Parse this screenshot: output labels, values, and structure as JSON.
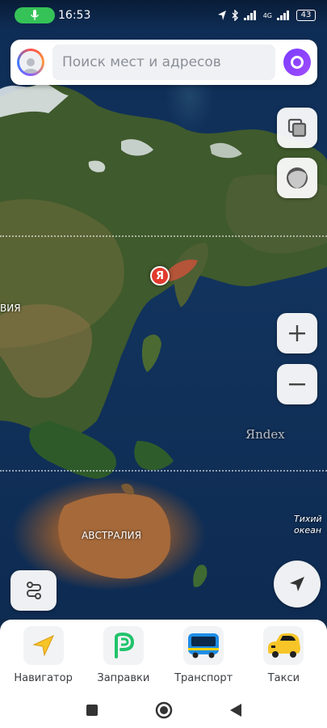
{
  "status_bar": {
    "time": "16:53",
    "battery": "43",
    "network": "4G"
  },
  "search": {
    "placeholder": "Поиск мест и адресов"
  },
  "map": {
    "labels": {
      "russia_partial": "ВИЯ",
      "australia": "АВСТРАЛИЯ",
      "pacific_line1": "Тихий",
      "pacific_line2": "океан",
      "watermark": "Яndex"
    },
    "pin_letter": "Я"
  },
  "services": [
    {
      "label": "Навигатор",
      "icon": "navigator-arrow-icon"
    },
    {
      "label": "Заправки",
      "icon": "refuel-icon"
    },
    {
      "label": "Транспорт",
      "icon": "bus-icon"
    },
    {
      "label": "Такси",
      "icon": "taxi-car-icon"
    }
  ],
  "colors": {
    "accent_purple": "#8a3dff",
    "mic_green": "#35c257",
    "pin_red": "#e23a2e"
  }
}
